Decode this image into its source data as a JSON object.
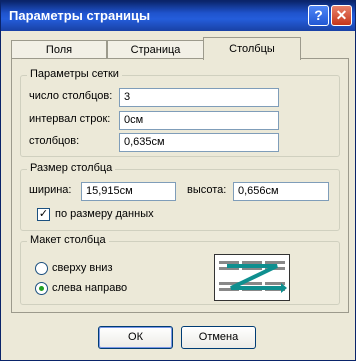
{
  "window": {
    "title": "Параметры страницы",
    "help_glyph": "?",
    "close_glyph": "✕"
  },
  "tabs": [
    {
      "label": "Поля"
    },
    {
      "label": "Страница"
    },
    {
      "label": "Столбцы"
    }
  ],
  "active_tab": "Столбцы",
  "grid": {
    "legend": "Параметры сетки",
    "columns_label": "число столбцов:",
    "columns_value": "3",
    "row_spacing_label": "интервал строк:",
    "row_spacing_value": "0см",
    "column_spacing_label": "столбцов:",
    "column_spacing_value": "0,635см"
  },
  "size": {
    "legend": "Размер столбца",
    "width_label": "ширина:",
    "width_value": "15,915см",
    "height_label": "высота:",
    "height_value": "0,656см",
    "autofit_label": "по размеру данных",
    "autofit_checked": true
  },
  "layout": {
    "legend": "Макет столбца",
    "option_down_label": "сверху вниз",
    "option_across_label": "слева направо",
    "selected": "слева направо"
  },
  "buttons": {
    "ok": "ОК",
    "cancel": "Отмена"
  }
}
